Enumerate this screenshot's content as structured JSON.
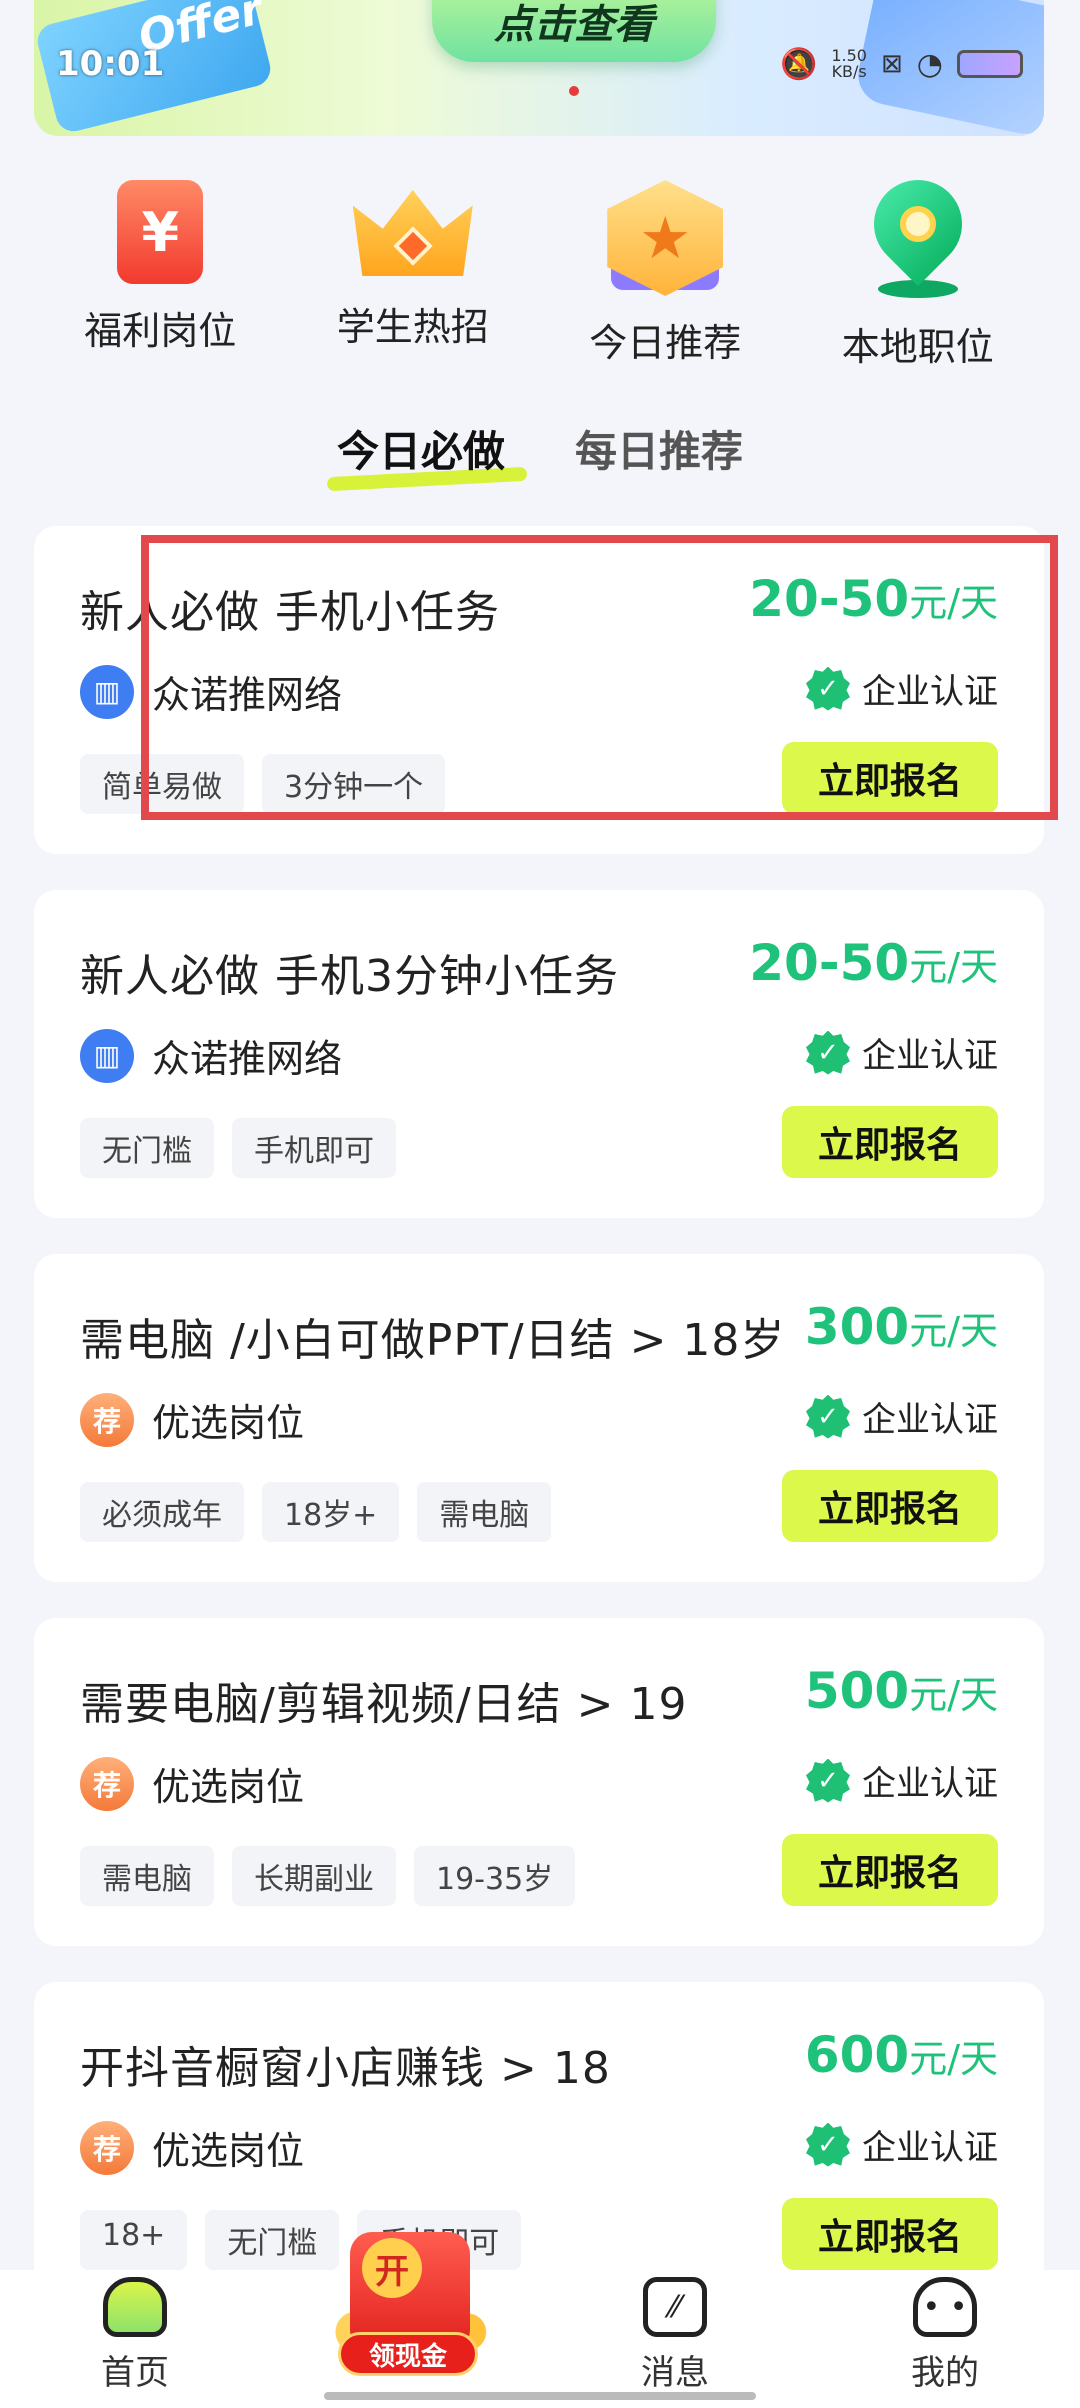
{
  "status_bar": {
    "time": "10:01",
    "net_speed_value": "1.50",
    "net_speed_unit": "KB/s"
  },
  "banner": {
    "card_text": "Offer",
    "button_label": "点击查看"
  },
  "quick_categories": [
    {
      "label": "福利岗位",
      "icon": "red-envelope-icon",
      "glyph": "¥"
    },
    {
      "label": "学生热招",
      "icon": "crown-icon"
    },
    {
      "label": "今日推荐",
      "icon": "star-hexagon-icon"
    },
    {
      "label": "本地职位",
      "icon": "location-pin-icon"
    }
  ],
  "tabs": [
    {
      "label": "今日必做",
      "active": true
    },
    {
      "label": "每日推荐",
      "active": false
    }
  ],
  "verify_label": "企业认证",
  "apply_label": "立即报名",
  "jobs": [
    {
      "title": "新人必做 手机小任务",
      "salary_amount": "20-50",
      "salary_unit": "元/天",
      "company": "众诺推网络",
      "logo_style": "blue",
      "tags": [
        "简单易做",
        "3分钟一个"
      ]
    },
    {
      "title": "新人必做 手机3分钟小任务",
      "salary_amount": "20-50",
      "salary_unit": "元/天",
      "company": "众诺推网络",
      "logo_style": "blue",
      "tags": [
        "无门槛",
        "手机即可"
      ]
    },
    {
      "title": "需电脑 /小白可做PPT/日结 > 18岁",
      "salary_amount": "300",
      "salary_unit": "元/天",
      "company": "优选岗位",
      "logo_style": "orange",
      "logo_glyph": "荐",
      "tags": [
        "必须成年",
        "18岁+",
        "需电脑"
      ]
    },
    {
      "title": "需要电脑/剪辑视频/日结 > 19",
      "salary_amount": "500",
      "salary_unit": "元/天",
      "company": "优选岗位",
      "logo_style": "orange",
      "logo_glyph": "荐",
      "tags": [
        "需电脑",
        "长期副业",
        "19-35岁"
      ]
    },
    {
      "title": "开抖音橱窗小店赚钱 > 18",
      "salary_amount": "600",
      "salary_unit": "元/天",
      "company": "优选岗位",
      "logo_style": "orange",
      "logo_glyph": "荐",
      "tags": [
        "18+",
        "无门槛",
        "手机即可"
      ]
    }
  ],
  "bottom_nav": {
    "home": "首页",
    "center_badge": "开",
    "center_label": "领现金",
    "messages": "消息",
    "me": "我的"
  },
  "colors": {
    "salary": "#1fc27a",
    "apply_button": "#dcf84b",
    "highlight_box": "#e2494c"
  }
}
